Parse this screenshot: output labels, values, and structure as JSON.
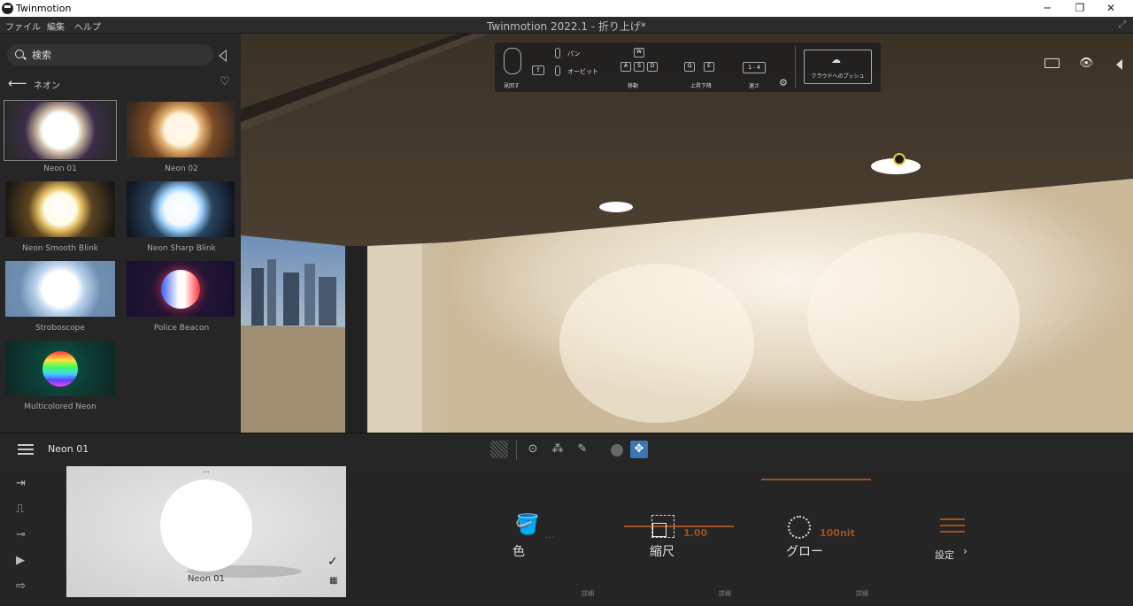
{
  "os": {
    "app_name": "Twinmotion"
  },
  "menu": {
    "items": [
      "ファイル",
      "編集",
      "ヘルプ"
    ]
  },
  "app_title": "Twinmotion 2022.1 - 折り上げ*",
  "search": {
    "placeholder": "検索"
  },
  "library": {
    "category": "ネオン",
    "items": [
      {
        "label": "Neon 01",
        "selected": true
      },
      {
        "label": "Neon 02"
      },
      {
        "label": "Neon Smooth Blink"
      },
      {
        "label": "Neon Sharp Blink"
      },
      {
        "label": "Stroboscope"
      },
      {
        "label": "Police Beacon"
      },
      {
        "label": "Multicolored Neon"
      }
    ]
  },
  "nav_toolbar": {
    "look": "見回す",
    "pan": "パン",
    "orbit": "オービット",
    "move": "移動",
    "updown": "上昇下降",
    "speed": "速さ",
    "speed_value": "1 - 4",
    "cloud_push": "クラウドへのプッシュ",
    "keys": {
      "w": "W",
      "a": "A",
      "s": "S",
      "d": "D",
      "q": "Q",
      "e": "E"
    }
  },
  "bottom_bar": {
    "selected_name": "Neon 01"
  },
  "preview": {
    "label": "Neon 01",
    "dots": "..."
  },
  "properties": {
    "color": {
      "label": "色",
      "value": "...",
      "detail": "詳細"
    },
    "scale": {
      "label": "縮尺",
      "value": "1.00",
      "detail": "詳細"
    },
    "glow": {
      "label": "グロー",
      "value": "100nit",
      "detail": "詳細"
    },
    "settings": {
      "label": "設定"
    }
  },
  "colors": {
    "accent": "#a0501e",
    "selection": "#3a76b4"
  }
}
